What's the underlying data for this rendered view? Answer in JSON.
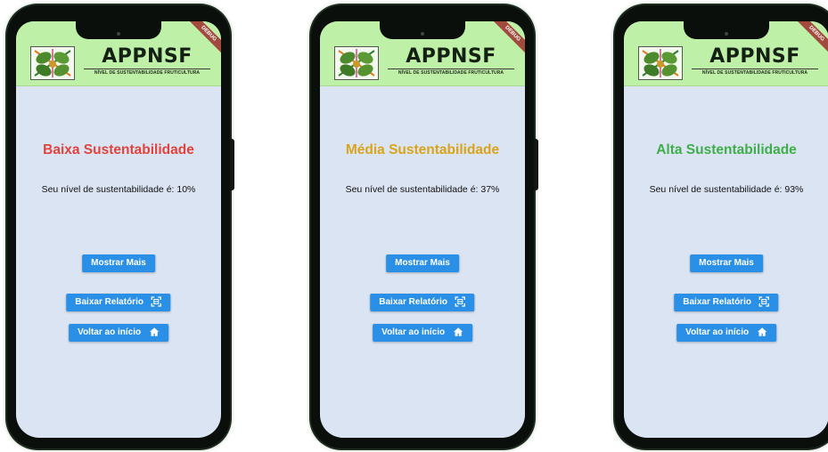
{
  "app": {
    "title": "APPNSF",
    "subtitle": "NÍVEL DE SUSTENTABILIDADE FRUTICULTURA",
    "debug_ribbon": "DEBUG"
  },
  "buttons": {
    "more": "Mostrar Mais",
    "report": "Baixar Relatório",
    "home": "Voltar ao início"
  },
  "icons": {
    "report": "qr-scan-icon",
    "home": "home-icon"
  },
  "screens": [
    {
      "title": "Baixa Sustentabilidade",
      "title_color": "#e0433b",
      "message": "Seu nível de sustentabilidade é: 10%",
      "percent": 10
    },
    {
      "title": "Média Sustentabilidade",
      "title_color": "#d9a419",
      "message": "Seu nível de sustentabilidade é: 37%",
      "percent": 37
    },
    {
      "title": "Alta Sustentabilidade",
      "title_color": "#3fae4a",
      "message": "Seu nível de sustentabilidade é: 93%",
      "percent": 93
    }
  ],
  "colors": {
    "appbar": "#bff0a8",
    "screen_bg": "#dbe4f3",
    "button": "#2a8fe6",
    "ribbon": "#a34a3e"
  }
}
